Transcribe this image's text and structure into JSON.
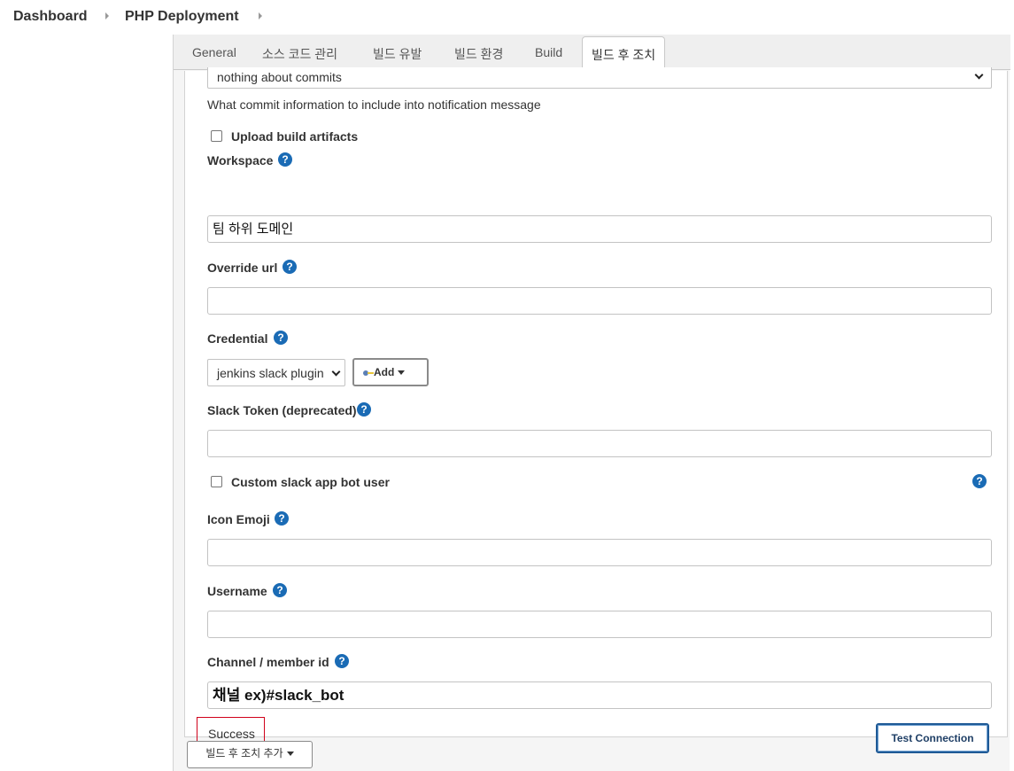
{
  "breadcrumb": {
    "items": [
      "Dashboard",
      "PHP Deployment"
    ]
  },
  "tabs": [
    "General",
    "소스 코드 관리",
    "빌드 유발",
    "빌드 환경",
    "Build",
    "빌드 후 조치"
  ],
  "active_tab": "빌드 후 조치",
  "form": {
    "commit_info_select_value": "nothing about commits",
    "commit_info_description": "What commit information to include into notification message",
    "upload_artifacts_label": "Upload build artifacts",
    "upload_artifacts_checked": false,
    "workspace": {
      "label": "Workspace",
      "value": "팀 하위 도메인"
    },
    "override_url": {
      "label": "Override url",
      "value": ""
    },
    "credential": {
      "label": "Credential",
      "select_value": "jenkins slack plugin",
      "add_button": "Add"
    },
    "slack_token": {
      "label": "Slack Token (deprecated)",
      "value": ""
    },
    "custom_bot_user": {
      "label": "Custom slack app bot user",
      "checked": false
    },
    "icon_emoji": {
      "label": "Icon Emoji",
      "value": ""
    },
    "username": {
      "label": "Username",
      "value": ""
    },
    "channel": {
      "label": "Channel / member id",
      "value": "채널 ex)#slack_bot"
    },
    "status_text": "Success",
    "test_connection_button": "Test Connection"
  },
  "add_post_build_action_button": "빌드 후 조치 추가",
  "icons": {
    "help": "?",
    "key": "key-icon"
  },
  "colors": {
    "help_icon": "#1a6bb5",
    "test_button_border": "#1f5a96",
    "highlight_box": "#d0021b"
  }
}
